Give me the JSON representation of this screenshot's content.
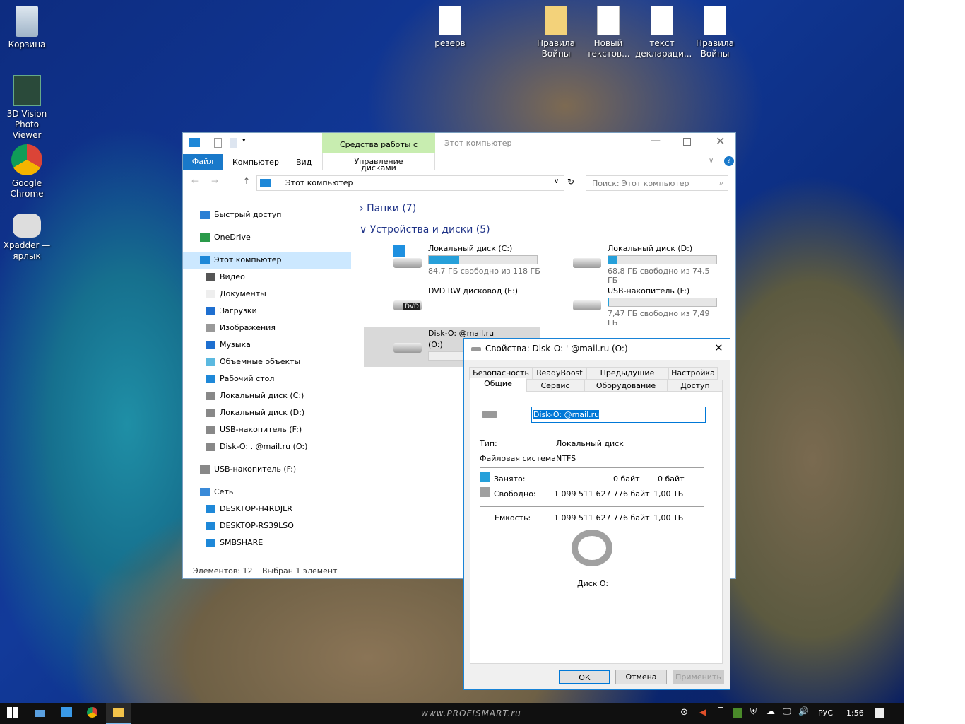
{
  "desktop": {
    "icons": [
      {
        "label": "Корзина",
        "icon": "recycle-bin-icon"
      },
      {
        "label": "3D Vision Photo Viewer",
        "icon": "3d-vision-icon"
      },
      {
        "label": "Google Chrome",
        "icon": "chrome-icon"
      },
      {
        "label": "Xpadder — ярлык",
        "icon": "gamepad-icon"
      },
      {
        "label": "резерв",
        "icon": "document-icon"
      },
      {
        "label": "Правила Войны",
        "icon": "folder-icon"
      },
      {
        "label": "Новый текстов...",
        "icon": "document-icon"
      },
      {
        "label": "текст деклараци...",
        "icon": "document-icon"
      },
      {
        "label": "Правила Войны",
        "icon": "document-icon"
      }
    ]
  },
  "explorer": {
    "context_tab": "Средства работы с дисками",
    "title": "Этот компьютер",
    "ribbon": {
      "file": "Файл",
      "computer": "Компьютер",
      "view": "Вид",
      "manage": "Управление"
    },
    "address": "Этот компьютер",
    "search_placeholder": "Поиск: Этот компьютер",
    "sidebar": [
      "Быстрый доступ",
      "OneDrive",
      "Этот компьютер",
      "Видео",
      "Документы",
      "Загрузки",
      "Изображения",
      "Музыка",
      "Объемные объекты",
      "Рабочий стол",
      "Локальный диск (C:)",
      "Локальный диск (D:)",
      "USB-накопитель (F:)",
      "Disk-O: .          @mail.ru (O:)",
      "USB-накопитель (F:)",
      "Сеть",
      "DESKTOP-H4RDJLR",
      "DESKTOP-RS39LSO",
      "SMBSHARE"
    ],
    "folders_group": "Папки (7)",
    "devices_group": "Устройства и диски (5)",
    "drives": [
      {
        "name": "Локальный диск (C:)",
        "free": "84,7 ГБ свободно из 118 ГБ",
        "used_pct": 28
      },
      {
        "name": "Локальный диск (D:)",
        "free": "68,8 ГБ свободно из 74,5 ГБ",
        "used_pct": 8
      },
      {
        "name": "DVD RW дисковод (E:)",
        "free": "",
        "badge": "DVD"
      },
      {
        "name": "USB-накопитель (F:)",
        "free": "7,47 ГБ свободно из 7,49 ГБ",
        "used_pct": 0.3
      },
      {
        "name": "Disk-O:          @mail.ru",
        "name2": "(O:)",
        "free": ""
      }
    ],
    "status_count": "Элементов: 12",
    "status_selected": "Выбран 1 элемент"
  },
  "dialog": {
    "title": "Свойства: Disk-O: '          @mail.ru (O:)",
    "tabs_top": [
      "Безопасность",
      "ReadyBoost",
      "Предыдущие версии",
      "Настройка"
    ],
    "tabs_bottom": [
      "Общие",
      "Сервис",
      "Оборудование",
      "Доступ"
    ],
    "name_value": "Disk-O:          @mail.ru",
    "type_label": "Тип:",
    "type_value": "Локальный диск",
    "fs_label": "Файловая система:",
    "fs_value": "NTFS",
    "used_label": "Занято:",
    "used_bytes": "0 байт",
    "used_size": "0 байт",
    "free_label": "Свободно:",
    "free_bytes": "1 099 511 627 776 байт",
    "free_size": "1,00 ТБ",
    "cap_label": "Емкость:",
    "cap_bytes": "1 099 511 627 776 байт",
    "cap_size": "1,00 ТБ",
    "disk_label": "Диск O:",
    "ok": "ОК",
    "cancel": "Отмена",
    "apply": "Применить",
    "colors": {
      "used": "#26a0da",
      "free": "#a0a0a0"
    }
  },
  "taskbar": {
    "watermark": "www.PROFISMART.ru",
    "lang": "РУС",
    "time": "1:56"
  }
}
